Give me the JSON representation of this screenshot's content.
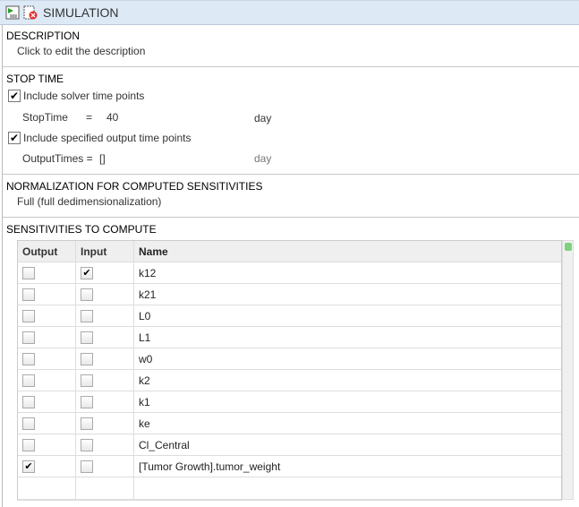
{
  "header": {
    "title": "SIMULATION",
    "icons": [
      "simulation-run-icon",
      "delete-simulation-icon"
    ]
  },
  "description": {
    "heading": "DESCRIPTION",
    "placeholder": "Click to edit the description"
  },
  "stop_time": {
    "heading": "STOP TIME",
    "include_solver": {
      "label": "Include solver time points",
      "checked": true
    },
    "stop_time_label": "StopTime",
    "eq": "=",
    "stop_time_value": "40",
    "stop_time_unit": "day",
    "include_output": {
      "label": "Include specified output time points",
      "checked": true
    },
    "output_times_label": "OutputTimes =",
    "output_times_value": "[]",
    "output_times_unit": "day"
  },
  "normalization": {
    "heading": "NORMALIZATION FOR COMPUTED SENSITIVITIES",
    "value": "Full (full dedimensionalization)"
  },
  "sensitivities": {
    "heading": "SENSITIVITIES TO COMPUTE",
    "columns": [
      "Output",
      "Input",
      "Name"
    ],
    "rows": [
      {
        "output": false,
        "input": true,
        "name": "k12"
      },
      {
        "output": false,
        "input": false,
        "name": "k21"
      },
      {
        "output": false,
        "input": false,
        "name": "L0"
      },
      {
        "output": false,
        "input": false,
        "name": "L1"
      },
      {
        "output": false,
        "input": false,
        "name": "w0"
      },
      {
        "output": false,
        "input": false,
        "name": "k2"
      },
      {
        "output": false,
        "input": false,
        "name": "k1"
      },
      {
        "output": false,
        "input": false,
        "name": "ke"
      },
      {
        "output": false,
        "input": false,
        "name": "Cl_Central"
      },
      {
        "output": true,
        "input": false,
        "name": "[Tumor Growth].tumor_weight"
      }
    ]
  }
}
